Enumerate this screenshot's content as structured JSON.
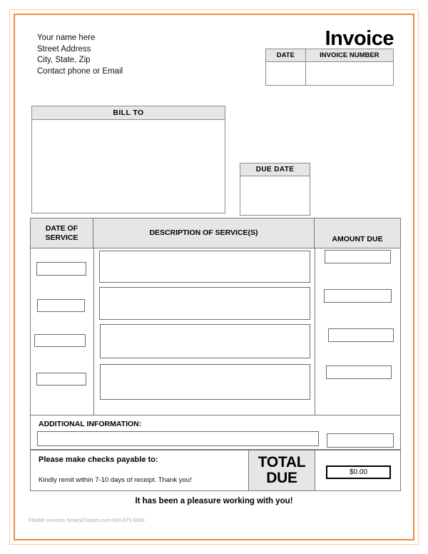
{
  "document": {
    "title": "Invoice",
    "fine_print": "Fillable Invoices NotaryClasses.com 800-873-9865"
  },
  "sender": {
    "line1": "Your name here",
    "line2": "Street Address",
    "line3": "City, State, Zip",
    "line4": "Contact phone or Email"
  },
  "invoice_meta": {
    "date_header": "DATE",
    "number_header": "INVOICE NUMBER",
    "date_value": "",
    "number_value": ""
  },
  "bill_to": {
    "header": "BILL TO",
    "value": ""
  },
  "due_date": {
    "header": "DUE DATE",
    "value": ""
  },
  "services": {
    "columns": {
      "date_line1": "DATE OF",
      "date_line2": "SERVICE",
      "description": "DESCRIPTION OF SERVICE(S)",
      "amount": "AMOUNT DUE"
    },
    "rows": [
      {
        "date": "",
        "description": "",
        "amount": ""
      },
      {
        "date": "",
        "description": "",
        "amount": ""
      },
      {
        "date": "",
        "description": "",
        "amount": ""
      },
      {
        "date": "",
        "description": "",
        "amount": ""
      }
    ]
  },
  "additional_information": {
    "label": "ADDITIONAL INFORMATION:",
    "value": "",
    "side_value": ""
  },
  "totals": {
    "payable_title": "Please make checks payable to:",
    "payable_note": "Kindly remit within 7-10 days of receipt. Thank you!",
    "total_label_line1": "TOTAL",
    "total_label_line2": "DUE",
    "total_amount": "$0.00"
  },
  "closing": {
    "message": "It has been a pleasure working with you!"
  },
  "colors": {
    "frame_outer": "#f6c9a6",
    "frame_inner": "#f08a3c",
    "header_fill": "#e6e6e6",
    "rule": "#7a7a7a",
    "field_border": "#6b6b6b"
  }
}
